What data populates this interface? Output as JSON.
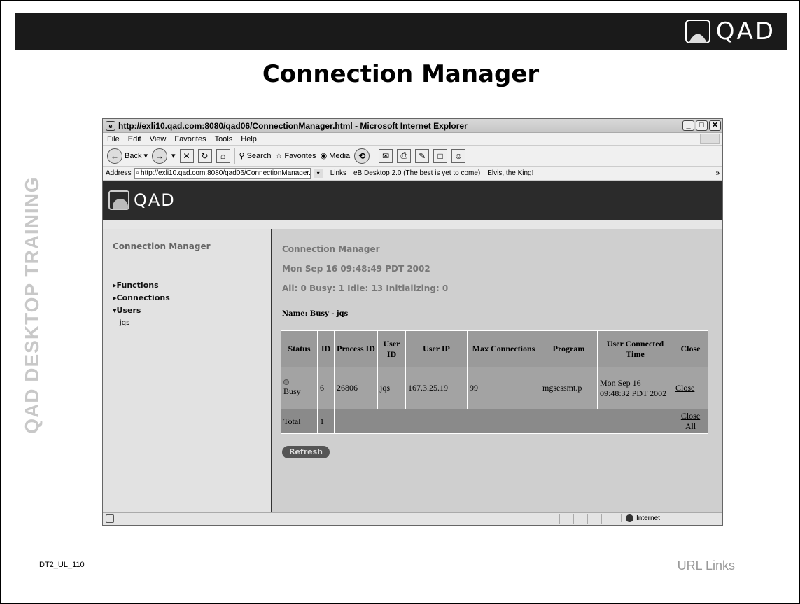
{
  "slide": {
    "logo_text": "QAD",
    "title": "Connection Manager",
    "side_text": "QAD DESKTOP TRAINING",
    "footer_code": "DT2_UL_110",
    "footer_topic": "URL Links"
  },
  "browser": {
    "window_title": "http://exli10.qad.com:8080/qad06/ConnectionManager.html - Microsoft Internet Explorer",
    "menu": [
      "File",
      "Edit",
      "View",
      "Favorites",
      "Tools",
      "Help"
    ],
    "toolbar": {
      "back": "Back",
      "search": "Search",
      "favorites": "Favorites",
      "media": "Media"
    },
    "address_label": "Address",
    "address_value": "http://exli10.qad.com:8080/qad06/ConnectionManager.ht",
    "links_label": "Links",
    "links": [
      "eB Desktop 2.0 (The best is yet to come)",
      "Elvis, the King!"
    ],
    "status_zone": "Internet"
  },
  "app": {
    "banner_logo": "QAD",
    "left_title": "Connection Manager",
    "tree": {
      "functions": "▸Functions",
      "connections": "▸Connections",
      "users": "▾Users",
      "user_child": "jqs"
    },
    "heading": "Connection Manager",
    "datetime": "Mon Sep 16 09:48:49 PDT 2002",
    "summary": "All: 0 Busy: 1 Idle: 13 Initializing: 0",
    "name_label": "Name: Busy - jqs",
    "table": {
      "headers": [
        "Status",
        "ID",
        "Process ID",
        "User ID",
        "User IP",
        "Max Connections",
        "Program",
        "User Connected Time",
        "Close"
      ],
      "row": {
        "status": "Busy",
        "id": "6",
        "process_id": "26806",
        "user_id": "jqs",
        "user_ip": "167.3.25.19",
        "max_connections": "99",
        "program": "mgsessmt.p",
        "connected_time": "Mon Sep 16 09:48:32 PDT 2002",
        "close": "Close"
      },
      "total_label": "Total",
      "total_count": "1",
      "close_all": "Close All"
    },
    "refresh_label": "Refresh"
  }
}
